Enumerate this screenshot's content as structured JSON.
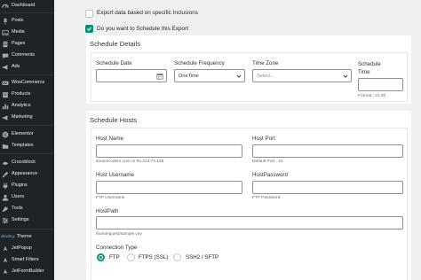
{
  "sidebar": {
    "items": [
      {
        "label": "Dashboard",
        "icon": "dashboard-icon"
      },
      {
        "label": "Posts",
        "icon": "pin-icon"
      },
      {
        "label": "Media",
        "icon": "media-icon"
      },
      {
        "label": "Pages",
        "icon": "page-icon"
      },
      {
        "label": "Comments",
        "icon": "comment-icon"
      },
      {
        "label": "Ads",
        "icon": "megaphone-icon"
      },
      {
        "label": "WooCommerce",
        "icon": "woo-icon"
      },
      {
        "label": "Products",
        "icon": "archive-icon"
      },
      {
        "label": "Analytics",
        "icon": "chart-icon"
      },
      {
        "label": "Marketing",
        "icon": "megaphone-icon"
      },
      {
        "label": "Elementor",
        "icon": "elementor-icon"
      },
      {
        "label": "Templates",
        "icon": "folder-icon"
      },
      {
        "label": "Crocoblock",
        "icon": "croco-icon"
      },
      {
        "label": "Appearance",
        "icon": "brush-icon"
      },
      {
        "label": "Plugins",
        "icon": "plug-icon"
      },
      {
        "label": "Users",
        "icon": "user-icon"
      },
      {
        "label": "Tools",
        "icon": "wrench-icon"
      },
      {
        "label": "Settings",
        "icon": "settings-icon"
      },
      {
        "label": "Theme",
        "icon": "theme-icon",
        "prefix": "Blocksy"
      },
      {
        "label": "JetPopup",
        "icon": "jet-icon"
      },
      {
        "label": "Smart Filters",
        "icon": "jet-icon"
      },
      {
        "label": "JetFormBuilder",
        "icon": "jet-icon"
      }
    ]
  },
  "options": {
    "export_inclusions": "Export data based on specific Inclusions",
    "schedule_export": "Do you want to Schedule this Export"
  },
  "schedule_details": {
    "title": "Schedule Details",
    "date_label": "Schedule Date",
    "date_value": "",
    "frequency_label": "Schedule Frequency",
    "frequency_value": "OneTime",
    "timezone_label": "Time Zone",
    "timezone_placeholder": "Select...",
    "time_label": "Schedule Time",
    "time_format": "Format : 21:20"
  },
  "schedule_hosts": {
    "title": "Schedule Hosts",
    "host_name_label": "Host Name",
    "host_name_help": "smackcoders.com or 54.213.74.129",
    "host_port_label": "Host Port",
    "host_port_help": "Default Port : 21",
    "host_username_label": "Host Username",
    "host_username_help": "FTP Username",
    "host_password_label": "HostPassword",
    "host_password_help": "FTP Password",
    "host_path_label": "HostPath",
    "host_path_help": "/home/guest/sample.csv",
    "connection_type_label": "Connection Type",
    "connection_types": [
      {
        "label": "FTP",
        "selected": true
      },
      {
        "label": "FTPS (SSL)",
        "selected": false
      },
      {
        "label": "SFTP",
        "selected": false
      }
    ],
    "connection_types_third_prefix": "SSH2 /"
  },
  "colors": {
    "sidebar_bg": "#1d2327",
    "accent": "#0b8d7c",
    "page_bg": "#f0f0f1"
  }
}
